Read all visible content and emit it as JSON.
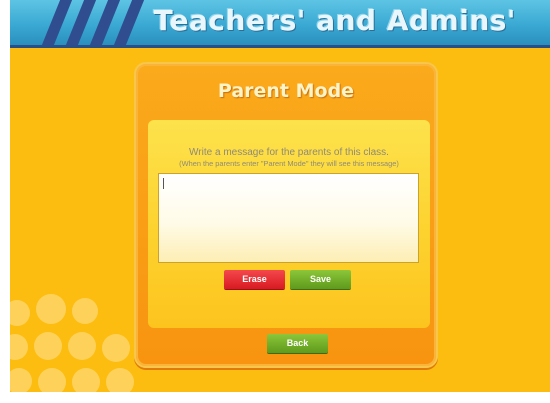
{
  "header": {
    "title": "Teachers' and Admins'"
  },
  "panel": {
    "title": "Parent Mode",
    "prompt": "Write a message for the parents of this class.",
    "hint": "(When the parents enter \"Parent Mode\" they will see this message)",
    "message_value": "",
    "erase_label": "Erase",
    "save_label": "Save",
    "back_label": "Back"
  },
  "colors": {
    "background": "#fdbd10",
    "banner": "#3aa9d3",
    "panel": "#f89410",
    "erase_button": "#d81a22",
    "action_button": "#5f9a1c"
  }
}
